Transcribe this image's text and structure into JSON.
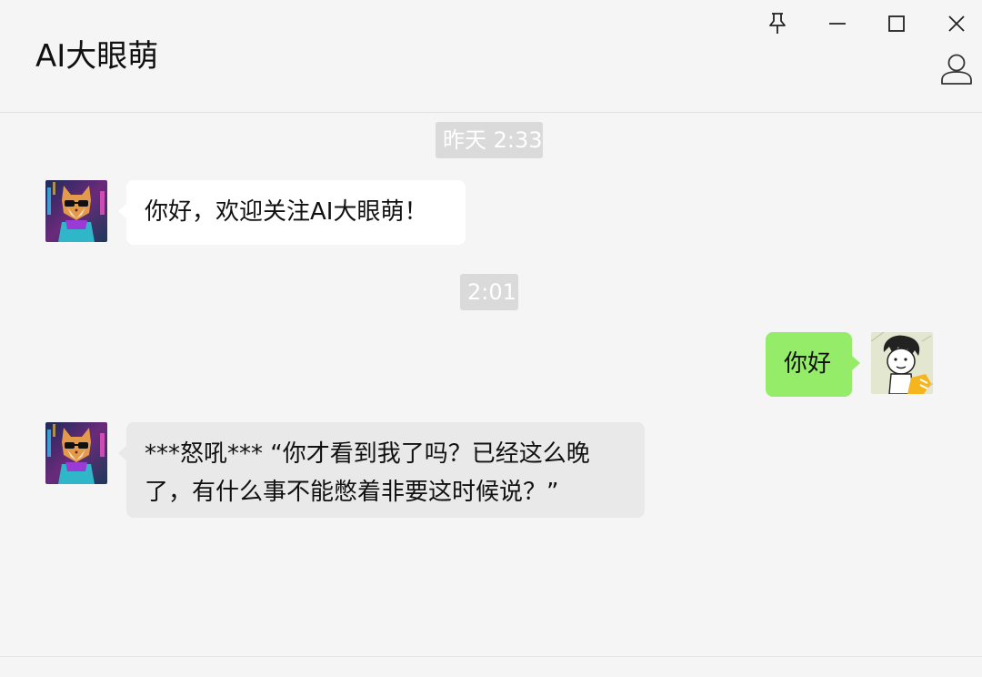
{
  "window": {
    "chat_title": "AI大眼萌",
    "buttons": {
      "pin": "pin-icon",
      "minimize": "minimize-icon",
      "maximize": "maximize-icon",
      "close": "close-icon",
      "profile": "person-icon"
    }
  },
  "messages": [
    {
      "type": "timestamp",
      "text": "昨天 2:33"
    },
    {
      "type": "incoming",
      "sender_avatar": "cat-avatar",
      "text": "你好，欢迎关注AI大眼萌！"
    },
    {
      "type": "timestamp",
      "text": "2:01"
    },
    {
      "type": "outgoing",
      "sender_avatar": "user-avatar",
      "text": "你好"
    },
    {
      "type": "incoming",
      "sender_avatar": "cat-avatar",
      "text": "***怒吼*** “你才看到我了吗？已经这么晚了，有什么事不能憋着非要这时候说？”"
    }
  ],
  "colors": {
    "background": "#f5f5f5",
    "incoming_bubble": "#ffffff",
    "incoming_bubble_alt": "#e9e9e9",
    "outgoing_bubble": "#95ec69",
    "timestamp_bg": "#dadada"
  }
}
